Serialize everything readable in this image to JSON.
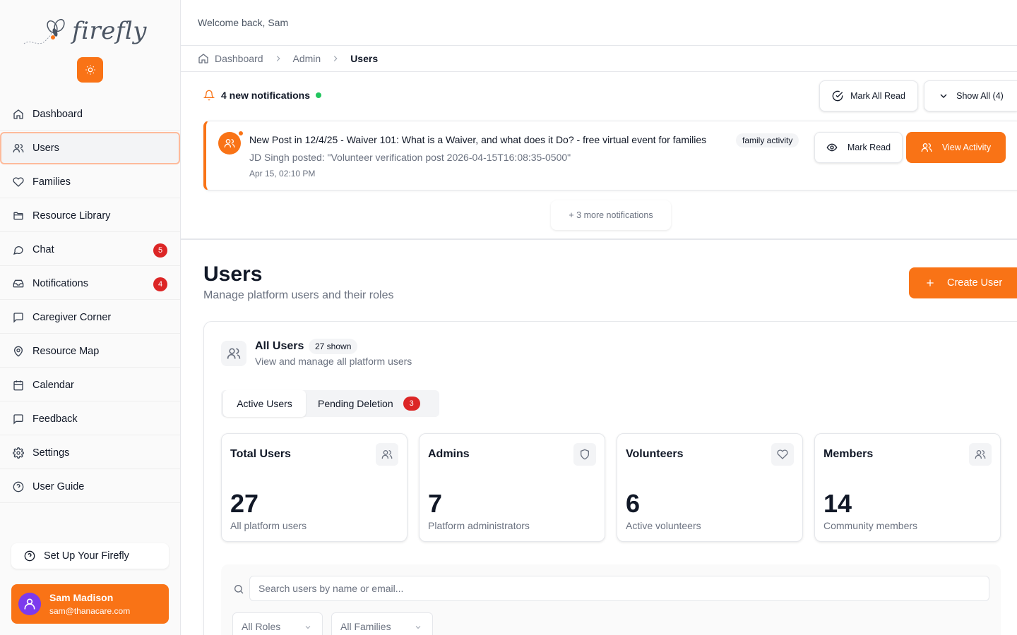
{
  "brand": {
    "name": "firefly",
    "accent": "#f97316"
  },
  "sidebar": {
    "items": [
      {
        "label": "Dashboard",
        "icon": "home-icon"
      },
      {
        "label": "Users",
        "icon": "users-icon",
        "active": true
      },
      {
        "label": "Families",
        "icon": "heart-icon"
      },
      {
        "label": "Resource Library",
        "icon": "folder-icon"
      },
      {
        "label": "Chat",
        "icon": "chat-icon",
        "badge": "5"
      },
      {
        "label": "Notifications",
        "icon": "inbox-icon",
        "badge": "4"
      },
      {
        "label": "Caregiver Corner",
        "icon": "message-square-icon"
      },
      {
        "label": "Resource Map",
        "icon": "map-pin-icon"
      },
      {
        "label": "Calendar",
        "icon": "calendar-icon"
      },
      {
        "label": "Feedback",
        "icon": "feedback-icon"
      },
      {
        "label": "Settings",
        "icon": "gear-icon"
      },
      {
        "label": "User Guide",
        "icon": "help-circle-icon"
      }
    ],
    "setup_label": "Set Up Your Firefly",
    "user": {
      "name": "Sam Madison",
      "email": "sam@thanacare.com"
    }
  },
  "header": {
    "welcome": "Welcome back, Sam"
  },
  "breadcrumb": {
    "items": [
      "Dashboard",
      "Admin",
      "Users"
    ]
  },
  "notifications": {
    "heading": "4 new notifications",
    "mark_all_read": "Mark All Read",
    "show_all": "Show All (4)",
    "card": {
      "title": "New Post in 12/4/25 - Waiver 101: What is a Waiver, and what does it Do? - free virtual event for families",
      "tag": "family activity",
      "body": "JD Singh posted: \"Volunteer verification post 2026-04-15T16:08:35-0500\"",
      "time": "Apr 15, 02:10 PM",
      "mark_read": "Mark Read",
      "view_activity": "View Activity"
    },
    "more": "+ 3 more notifications"
  },
  "page": {
    "title": "Users",
    "subtitle": "Manage platform users and their roles",
    "create_button": "Create User"
  },
  "users_card": {
    "title": "All Users",
    "shown": "27 shown",
    "subtitle": "View and manage all platform users",
    "tabs": {
      "active": "Active Users",
      "pending": "Pending Deletion",
      "pending_count": "3"
    },
    "stats": [
      {
        "label": "Total Users",
        "value": "27",
        "desc": "All platform users",
        "icon": "users-icon"
      },
      {
        "label": "Admins",
        "value": "7",
        "desc": "Platform administrators",
        "icon": "shield-icon"
      },
      {
        "label": "Volunteers",
        "value": "6",
        "desc": "Active volunteers",
        "icon": "heart-icon"
      },
      {
        "label": "Members",
        "value": "14",
        "desc": "Community members",
        "icon": "users-icon"
      }
    ],
    "search": {
      "placeholder": "Search users by name or email...",
      "value": ""
    },
    "filters": {
      "roles": "All Roles",
      "families": "All Families"
    }
  }
}
